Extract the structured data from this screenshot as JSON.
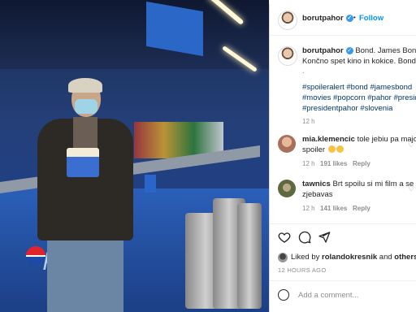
{
  "post_header": {
    "username": "borutpahor",
    "separator": "•",
    "follow_label": "Follow"
  },
  "caption": {
    "username": "borutpahor",
    "line1": "Bond. James Bond. 🍿",
    "line2": "Končno spet kino in kokice. Bond ne",
    "dots": ".",
    "hashtags_line1": "#spoileralert #bond #jamesbond",
    "hashtags_line2": "#movies #popcorn #pahor #preside",
    "hashtags_line3": "#presidentpahor #slovenia",
    "time": "12 h"
  },
  "comments": [
    {
      "username": "mia.klemencic",
      "text_line1": "tole jebiu pa major",
      "text_line2": "spoiler",
      "time": "12 h",
      "likes": "191 likes",
      "reply": "Reply"
    },
    {
      "username": "tawnics",
      "text_line1": "Brt spoilu si mi film a se",
      "text_line2": "zjebavas",
      "time": "12 h",
      "likes": "141 likes",
      "reply": "Reply"
    }
  ],
  "actions": {
    "like_icon": "heart-icon",
    "comment_icon": "comment-icon",
    "share_icon": "share-icon"
  },
  "likes_summary": {
    "prefix": "Liked by",
    "user": "rolandokresnik",
    "and": "and",
    "others": "others"
  },
  "post_time": "12 HOURS AGO",
  "add_comment": {
    "placeholder": "Add a comment..."
  },
  "photo": {
    "pepsi_text": "pepsi"
  },
  "colors": {
    "link_blue": "#0095f6",
    "verified_blue": "#3897f0",
    "hashtag": "#00376b",
    "muted": "#8e8e8e"
  }
}
